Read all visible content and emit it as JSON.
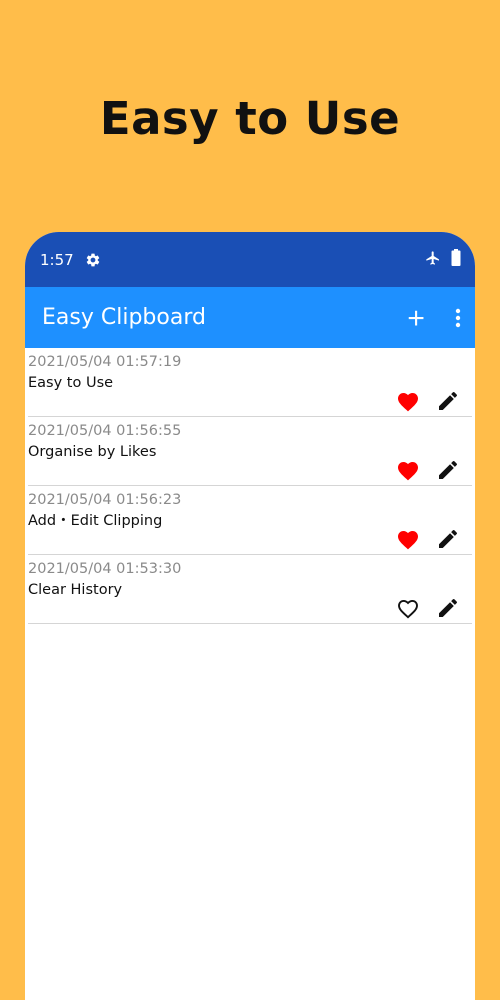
{
  "headline": "Easy to Use",
  "status_bar": {
    "time": "1:57"
  },
  "app_bar": {
    "title": "Easy Clipboard"
  },
  "clips": [
    {
      "date": "2021/05/04 01:57:19",
      "text": "Easy to Use",
      "liked": true
    },
    {
      "date": "2021/05/04 01:56:55",
      "text": "Organise by Likes",
      "liked": true
    },
    {
      "date": "2021/05/04 01:56:23",
      "text": "Add・Edit Clipping",
      "liked": true
    },
    {
      "date": "2021/05/04 01:53:30",
      "text": "Clear History",
      "liked": false
    }
  ],
  "colors": {
    "background": "#FFBD4A",
    "status_bar": "#1A4FB5",
    "app_bar": "#1E90FF",
    "heart": "#FF0000"
  }
}
